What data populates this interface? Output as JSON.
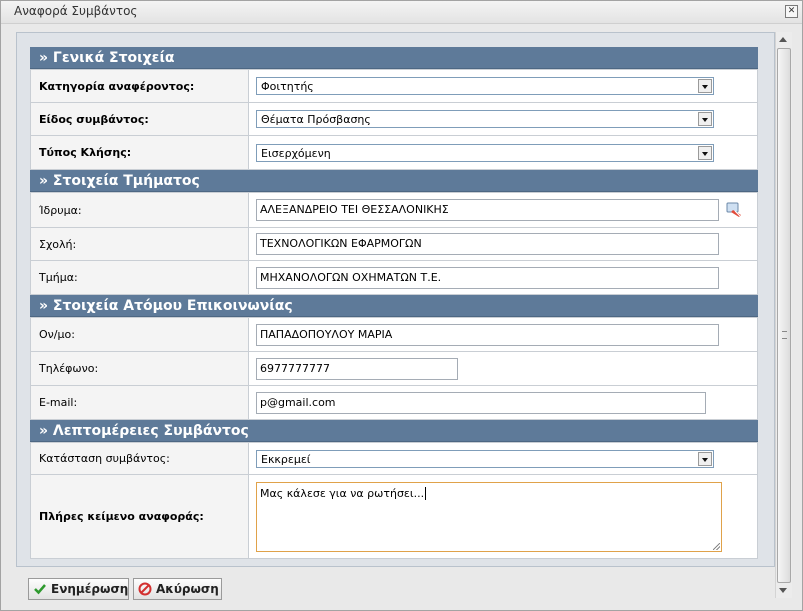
{
  "window": {
    "title": "Αναφορά Συμβάντος",
    "close_glyph": "✕"
  },
  "sections": {
    "general": "» Γενικά Στοιχεία",
    "department": "» Στοιχεία Τμήματος",
    "contact": "» Στοιχεία Ατόμου Επικοινωνίας",
    "details": "» Λεπτομέρειες Συμβάντος"
  },
  "general": {
    "reporter_category_label": "Κατηγορία αναφέροντος:",
    "reporter_category_value": "Φοιτητής",
    "incident_type_label": "Είδος συμβάντος:",
    "incident_type_value": "Θέματα Πρόσβασης",
    "call_type_label": "Τύπος Κλήσης:",
    "call_type_value": "Εισερχόμενη"
  },
  "department": {
    "institution_label": "Ίδρυμα:",
    "institution_value": "ΑΛΕΞΑΝΔΡΕΙΟ ΤΕΙ ΘΕΣΣΑΛΟΝΙΚΗΣ",
    "school_label": "Σχολή:",
    "school_value": "ΤΕΧΝΟΛΟΓΙΚΩΝ ΕΦΑΡΜΟΓΩΝ",
    "dept_label": "Τμήμα:",
    "dept_value": "ΜΗΧΑΝΟΛΟΓΩΝ ΟΧΗΜΑΤΩΝ Τ.Ε."
  },
  "contact": {
    "name_label": "Ον/μο:",
    "name_value": "ΠΑΠΑΔΟΠΟΥΛΟΥ ΜΑΡΙΑ",
    "phone_label": "Τηλέφωνο:",
    "phone_value": "6977777777",
    "email_label": "E-mail:",
    "email_value": "p@gmail.com"
  },
  "details": {
    "status_label": "Κατάσταση συμβάντος:",
    "status_value": "Εκκρεμεί",
    "fulltext_label": "Πλήρες κείμενο αναφοράς:",
    "fulltext_value": "Μας κάλεσε για να ρωτήσει..."
  },
  "buttons": {
    "update": "Ενημέρωση",
    "cancel": "Ακύρωση"
  },
  "colors": {
    "section_header": "#5e7a99",
    "textarea_focus": "#e0a24a",
    "update_icon": "#2f9a2f",
    "cancel_icon": "#d33030"
  },
  "icons": {
    "erase": "eraser-icon",
    "update": "check-icon",
    "cancel": "cancel-icon"
  }
}
